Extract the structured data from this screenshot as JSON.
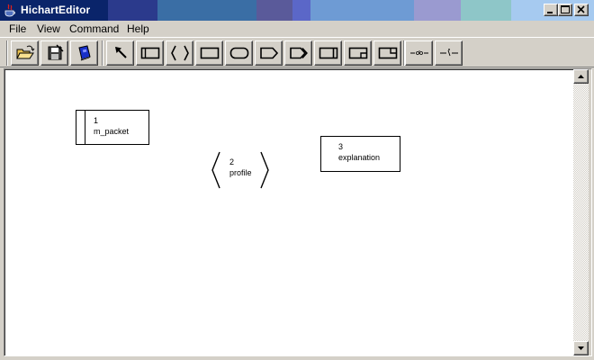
{
  "window": {
    "title": "HichartEditor"
  },
  "menu": {
    "items": [
      "File",
      "View",
      "Command",
      "Help"
    ]
  },
  "toolbar": {
    "buttons": [
      {
        "name": "open-file-icon"
      },
      {
        "name": "save-file-icon"
      },
      {
        "name": "book-icon"
      },
      {
        "name": "pointer-arrow-icon"
      },
      {
        "name": "bar-box-tool-icon"
      },
      {
        "name": "brace-tool-icon"
      },
      {
        "name": "rectangle-tool-icon"
      },
      {
        "name": "rounded-rectangle-tool-icon"
      },
      {
        "name": "pentagon-tool-icon"
      },
      {
        "name": "chevron-tool-icon"
      },
      {
        "name": "box-right-bar-tool-icon"
      },
      {
        "name": "box-corner-tool-icon"
      },
      {
        "name": "box-notch-tool-icon"
      },
      {
        "name": "connector-circle-tool-icon"
      },
      {
        "name": "connector-split-tool-icon"
      }
    ]
  },
  "diagram": {
    "nodes": [
      {
        "num": "1",
        "label": "m_packet",
        "shape": "bar-box"
      },
      {
        "num": "2",
        "label": "profile",
        "shape": "brace"
      },
      {
        "num": "3",
        "label": "explanation",
        "shape": "box"
      }
    ]
  },
  "colors": {
    "title_text": "#ffffff",
    "face": "#d4d0c8",
    "canvas": "#ffffff"
  }
}
